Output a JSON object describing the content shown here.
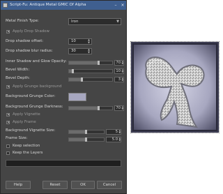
{
  "dialog": {
    "title": "Script-Fu: Antique Metal GMIC Of Alpha",
    "window_buttons": {
      "minimize": "–",
      "close": "×"
    }
  },
  "fields": {
    "metal_finish": {
      "label": "Metal Finish Type:",
      "value": "Iron"
    },
    "apply_drop_shadow": {
      "label": "Apply Drop Shadow",
      "checked": true
    },
    "drop_shadow_offset": {
      "label": "Drop shadow offset:",
      "value": "10"
    },
    "drop_shadow_blur": {
      "label": "Drop shadow blur radius:",
      "value": "30"
    },
    "inner_shadow_glow": {
      "label": "Inner Shadow and Glow Opacity:",
      "value": "70",
      "level": 0.7
    },
    "bevel_width": {
      "label": "Bevel Width:",
      "value": "10",
      "level": 0.1
    },
    "bevel_depth": {
      "label": "Bevel Depth:",
      "value": "3",
      "level": 0.3
    },
    "apply_grunge": {
      "label": "Apply Grunge background",
      "checked": true
    },
    "bg_grunge_color": {
      "label": "Background Grunge Color:",
      "color": "#a7a7c0"
    },
    "bg_grunge_darkness": {
      "label": "Background Grunge Darkness:",
      "value": "70",
      "level": 0.7
    },
    "apply_vignette": {
      "label": "Apply Vignette",
      "checked": true
    },
    "apply_frame": {
      "label": "Apply Frame",
      "checked": true
    },
    "bg_vignette_size": {
      "label": "Background Vignette Size:",
      "value": "5",
      "level": 0.5
    },
    "frame_size": {
      "label": "Frame Size:",
      "value": "5.0",
      "level": 0.5
    },
    "keep_selection": {
      "label": "Keep selection",
      "checked": false
    },
    "keep_layers": {
      "label": "Keep the Layers",
      "checked": false
    }
  },
  "buttons": {
    "help": "Help",
    "reset": "Reset",
    "ok": "OK",
    "cancel": "Cancel"
  },
  "colors": {
    "title_bar": "#3f5f8f",
    "dialog_bg": "#454545",
    "preview_frame": "#a7a7c0"
  }
}
